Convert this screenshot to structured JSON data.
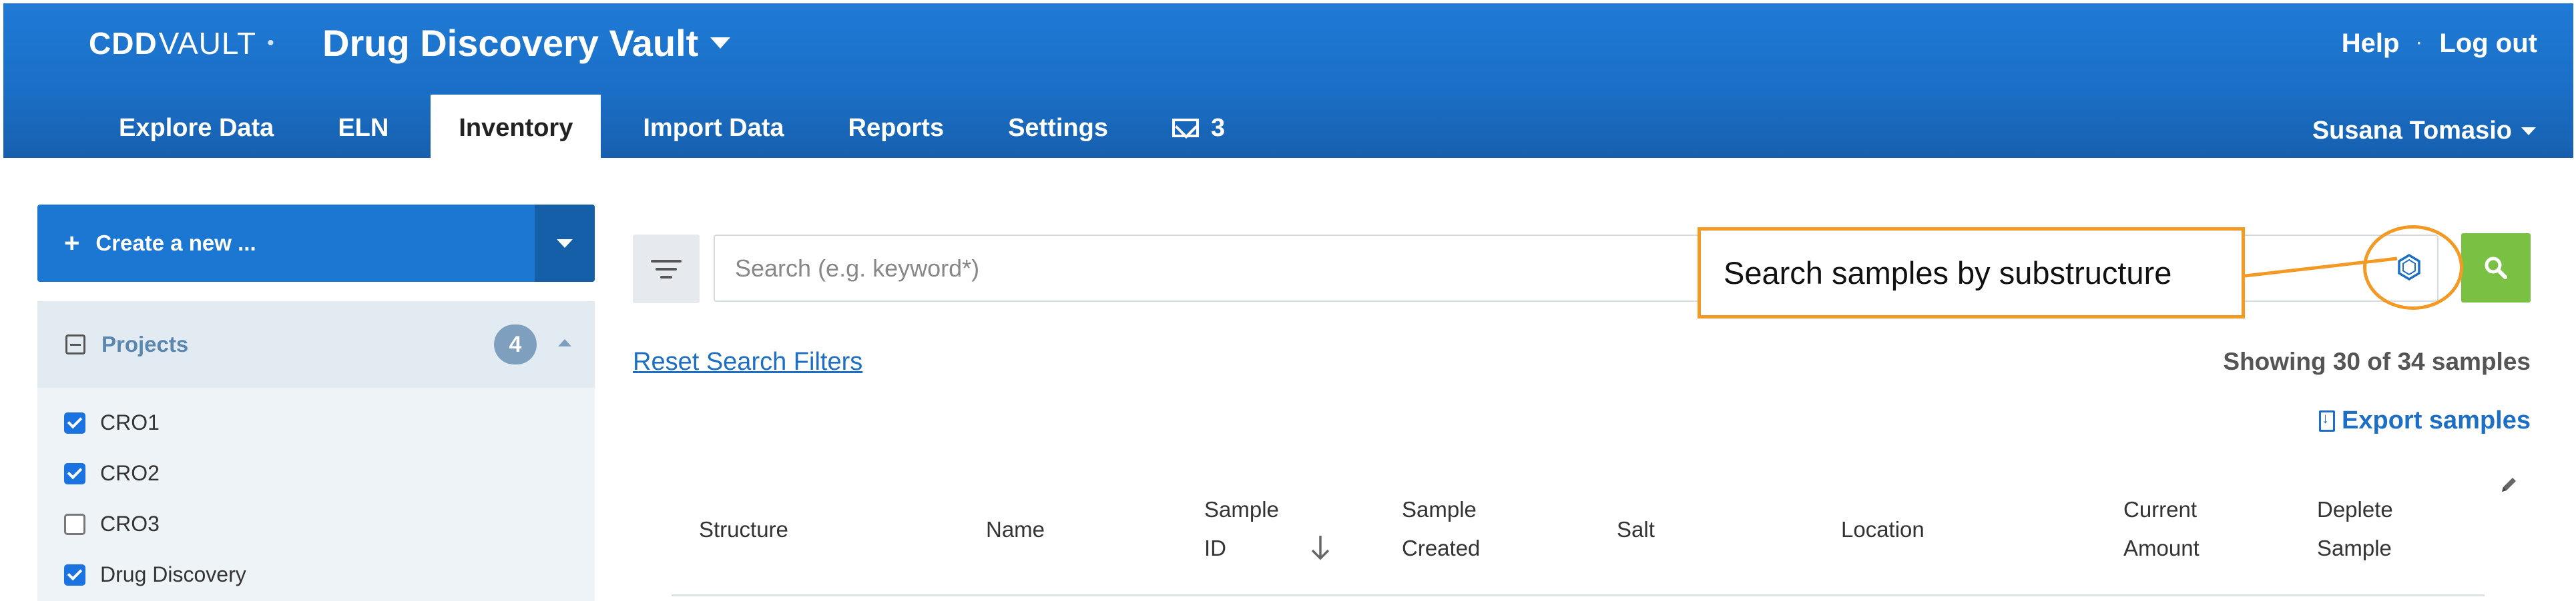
{
  "header": {
    "logo_cdd": "CDD",
    "logo_vault": "VAULT",
    "logo_dot": "•",
    "vault_title": "Drug Discovery Vault",
    "help": "Help",
    "separator": "·",
    "logout": "Log out",
    "user_name": "Susana Tomasio"
  },
  "nav": {
    "tabs": [
      {
        "label": "Explore Data"
      },
      {
        "label": "ELN"
      },
      {
        "label": "Inventory",
        "active": true
      },
      {
        "label": "Import Data"
      },
      {
        "label": "Reports"
      },
      {
        "label": "Settings"
      }
    ],
    "messages_count": "3"
  },
  "sidebar": {
    "create_label": "Create a new ...",
    "create_plus": "+",
    "projects_label": "Projects",
    "projects_count": "4",
    "projects": [
      {
        "name": "CRO1",
        "checked": true
      },
      {
        "name": "CRO2",
        "checked": true
      },
      {
        "name": "CRO3",
        "checked": false
      },
      {
        "name": "Drug Discovery",
        "checked": true
      }
    ]
  },
  "search": {
    "placeholder": "Search (e.g. keyword*)",
    "callout": "Search  samples by substructure",
    "reset_label": "Reset Search Filters",
    "showing": "Showing 30 of 34 samples",
    "export_label": "Export samples"
  },
  "table": {
    "columns": [
      {
        "line1": "Structure",
        "line2": ""
      },
      {
        "line1": "Name",
        "line2": ""
      },
      {
        "line1": "Sample",
        "line2": "ID"
      },
      {
        "line1": "Sample",
        "line2": "Created"
      },
      {
        "line1": "Salt",
        "line2": ""
      },
      {
        "line1": "Location",
        "line2": ""
      },
      {
        "line1": "Current",
        "line2": "Amount"
      },
      {
        "line1": "Deplete",
        "line2": "Sample"
      }
    ]
  },
  "colors": {
    "header_blue": "#1a6ec4",
    "accent_blue": "#1b77d2",
    "search_green": "#7ac143",
    "callout_orange": "#f39a25",
    "link_blue": "#1d6fc5"
  },
  "icons": {
    "filter": "filter-lines-icon",
    "structure": "hexagon-structure-icon",
    "search": "magnifier-icon",
    "mail": "envelope-icon",
    "export": "file-download-icon",
    "sort": "arrow-down-icon",
    "edit": "pencil-icon"
  }
}
